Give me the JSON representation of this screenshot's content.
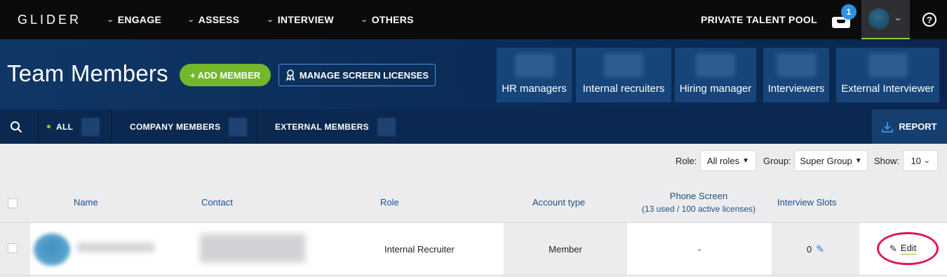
{
  "nav": {
    "logo": "GLIDER",
    "items": [
      {
        "label": "ENGAGE"
      },
      {
        "label": "ASSESS"
      },
      {
        "label": "INTERVIEW"
      },
      {
        "label": "OTHERS"
      }
    ],
    "private_pool": "PRIVATE TALENT POOL",
    "notification_count": "1",
    "help": "?"
  },
  "hero": {
    "title": "Team Members",
    "add_member": "+ ADD MEMBER",
    "manage_licenses": "MANAGE SCREEN LICENSES",
    "roles": [
      {
        "label": "HR managers"
      },
      {
        "label": "Internal recruiters"
      },
      {
        "label": "Hiring manager"
      },
      {
        "label": "Interviewers"
      },
      {
        "label": "External Interviewer"
      }
    ]
  },
  "tabs": {
    "all": "ALL",
    "company": "COMPANY MEMBERS",
    "external": "EXTERNAL MEMBERS",
    "report": "REPORT"
  },
  "filters": {
    "role_label": "Role:",
    "role_value": "All roles",
    "group_label": "Group:",
    "group_value": "Super Group",
    "show_label": "Show:",
    "show_value": "10"
  },
  "table": {
    "headers": {
      "name": "Name",
      "contact": "Contact",
      "role": "Role",
      "account_type": "Account type",
      "phone_screen": "Phone Screen",
      "phone_screen_sub": "(13 used / 100 active licenses)",
      "interview_slots": "Interview Slots"
    },
    "rows": [
      {
        "role": "Internal Recruiter",
        "account_type": "Member",
        "phone_screen": "-",
        "interview_slots": "0",
        "edit": "Edit"
      }
    ]
  },
  "colors": {
    "accent_green": "#72b82a",
    "accent_blue": "#2f8fe8",
    "highlight": "#e0155d"
  }
}
